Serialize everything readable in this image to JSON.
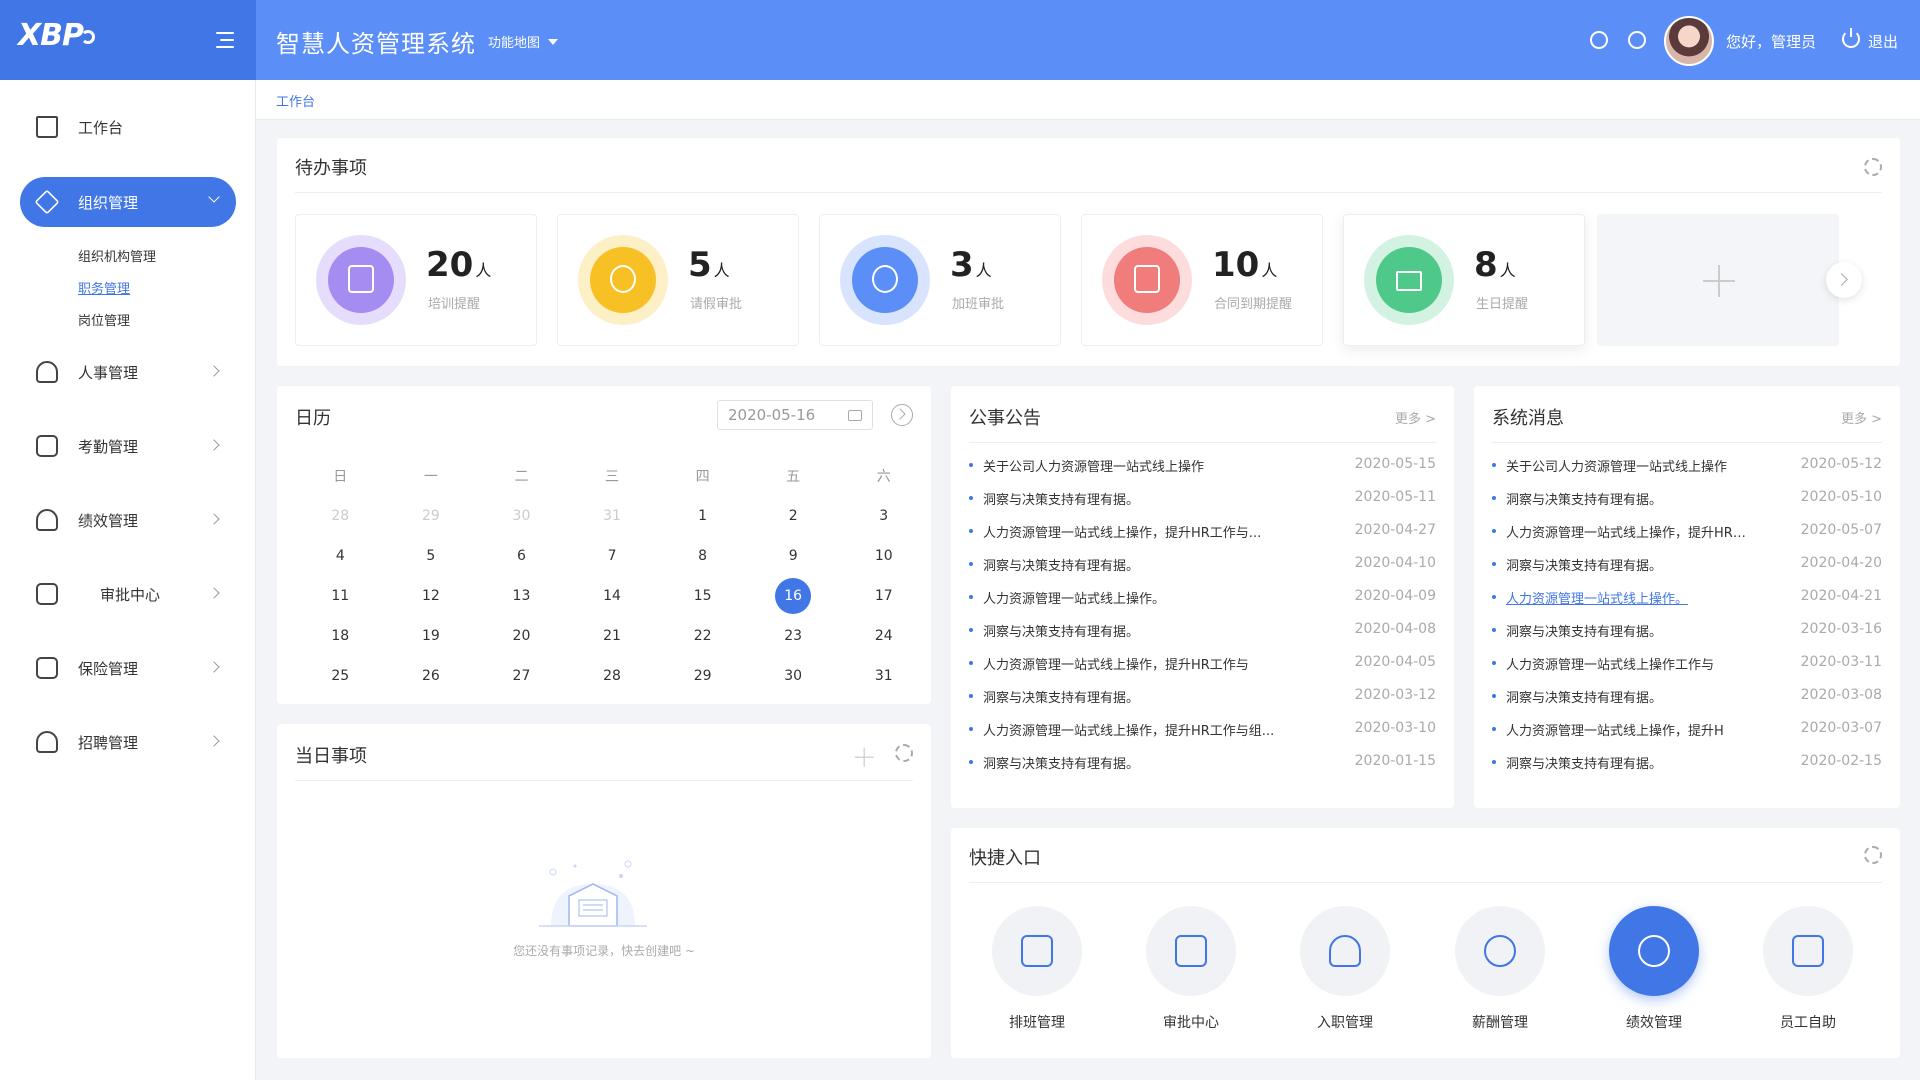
{
  "brand": {
    "logo_text": "XBP"
  },
  "header": {
    "title": "智慧人资管理系统",
    "func_map": "功能地图",
    "greeting": "您好，管理员",
    "logout": "退出",
    "icons": [
      "search-icon",
      "help-icon",
      "avatar",
      "power-icon"
    ]
  },
  "sidebar": {
    "items": [
      {
        "label": "工作台",
        "icon": "home-icon"
      },
      {
        "label": "组织管理",
        "icon": "layers-icon",
        "active": true,
        "children": [
          "组织机构管理",
          "职务管理",
          "岗位管理"
        ],
        "current_child": "职务管理"
      },
      {
        "label": "人事管理",
        "icon": "user-icon"
      },
      {
        "label": "考勤管理",
        "icon": "calendar-check-icon"
      },
      {
        "label": "绩效管理",
        "icon": "user-edit-icon"
      },
      {
        "label": "审批中心",
        "icon": "doc-approve-icon"
      },
      {
        "label": "保险管理",
        "icon": "doc-shield-icon"
      },
      {
        "label": "招聘管理",
        "icon": "user-add-icon"
      }
    ]
  },
  "breadcrumb": "工作台",
  "todo": {
    "title": "待办事项",
    "unit": "人",
    "items": [
      {
        "num": "20",
        "label": "培训提醒",
        "color": "#a58cf0",
        "ring": "#e5ddfb"
      },
      {
        "num": "5",
        "label": "请假审批",
        "color": "#f7c024",
        "ring": "#fdf0c6"
      },
      {
        "num": "3",
        "label": "加班审批",
        "color": "#5b8ff7",
        "ring": "#d8e4fd"
      },
      {
        "num": "10",
        "label": "合同到期提醒",
        "color": "#f07c7c",
        "ring": "#fcdcdc"
      },
      {
        "num": "8",
        "label": "生日提醒",
        "color": "#4fc98a",
        "ring": "#d3f2e2"
      }
    ]
  },
  "calendar": {
    "title": "日历",
    "date": "2020-05-16",
    "weekdays": [
      "日",
      "一",
      "二",
      "三",
      "四",
      "五",
      "六"
    ],
    "rows": [
      [
        "28",
        "29",
        "30",
        "31",
        "1",
        "2",
        "3"
      ],
      [
        "4",
        "5",
        "6",
        "7",
        "8",
        "9",
        "10"
      ],
      [
        "11",
        "12",
        "13",
        "14",
        "15",
        "16",
        "17"
      ],
      [
        "18",
        "19",
        "20",
        "21",
        "22",
        "23",
        "24"
      ],
      [
        "25",
        "26",
        "27",
        "28",
        "29",
        "30",
        "31"
      ]
    ],
    "today": "16"
  },
  "daily": {
    "title": "当日事项",
    "empty": "您还没有事项记录，快去创建吧 ~"
  },
  "notice": {
    "title": "公事公告",
    "more": "更多 >",
    "items": [
      {
        "t": "关于公司人力资源管理一站式线上操作",
        "d": "2020-05-15"
      },
      {
        "t": "洞察与决策支持有理有据。",
        "d": "2020-05-11"
      },
      {
        "t": "人力资源管理一站式线上操作，提升HR工作与...",
        "d": "2020-04-27"
      },
      {
        "t": "洞察与决策支持有理有据。",
        "d": "2020-04-10"
      },
      {
        "t": "人力资源管理一站式线上操作。",
        "d": "2020-04-09"
      },
      {
        "t": "洞察与决策支持有理有据。",
        "d": "2020-04-08"
      },
      {
        "t": "人力资源管理一站式线上操作，提升HR工作与",
        "d": "2020-04-05"
      },
      {
        "t": "洞察与决策支持有理有据。",
        "d": "2020-03-12"
      },
      {
        "t": "人力资源管理一站式线上操作，提升HR工作与组...",
        "d": "2020-03-10"
      },
      {
        "t": "洞察与决策支持有理有据。",
        "d": "2020-01-15"
      }
    ]
  },
  "sysmsg": {
    "title": "系统消息",
    "more": "更多 >",
    "items": [
      {
        "t": "关于公司人力资源管理一站式线上操作",
        "d": "2020-05-12"
      },
      {
        "t": "洞察与决策支持有理有据。",
        "d": "2020-05-10"
      },
      {
        "t": "人力资源管理一站式线上操作，提升HR工...",
        "d": "2020-05-07"
      },
      {
        "t": "洞察与决策支持有理有据。",
        "d": "2020-04-20"
      },
      {
        "t": "人力资源管理一站式线上操作。",
        "d": "2020-04-21",
        "link": true
      },
      {
        "t": "洞察与决策支持有理有据。",
        "d": "2020-03-16"
      },
      {
        "t": "人力资源管理一站式线上操作工作与",
        "d": "2020-03-11"
      },
      {
        "t": "洞察与决策支持有理有据。",
        "d": "2020-03-08"
      },
      {
        "t": "人力资源管理一站式线上操作，提升H",
        "d": "2020-03-07"
      },
      {
        "t": "洞察与决策支持有理有据。",
        "d": "2020-02-15"
      }
    ]
  },
  "quick": {
    "title": "快捷入口",
    "items": [
      {
        "label": "排班管理",
        "icon": "schedule-icon"
      },
      {
        "label": "审批中心",
        "icon": "approval-icon"
      },
      {
        "label": "入职管理",
        "icon": "onboard-icon"
      },
      {
        "label": "薪酬管理",
        "icon": "salary-icon"
      },
      {
        "label": "绩效管理",
        "icon": "performance-icon",
        "active": true
      },
      {
        "label": "员工自助",
        "icon": "self-service-icon"
      }
    ]
  },
  "colors": {
    "primary": "#4176e6",
    "header": "#5b8ff7"
  }
}
